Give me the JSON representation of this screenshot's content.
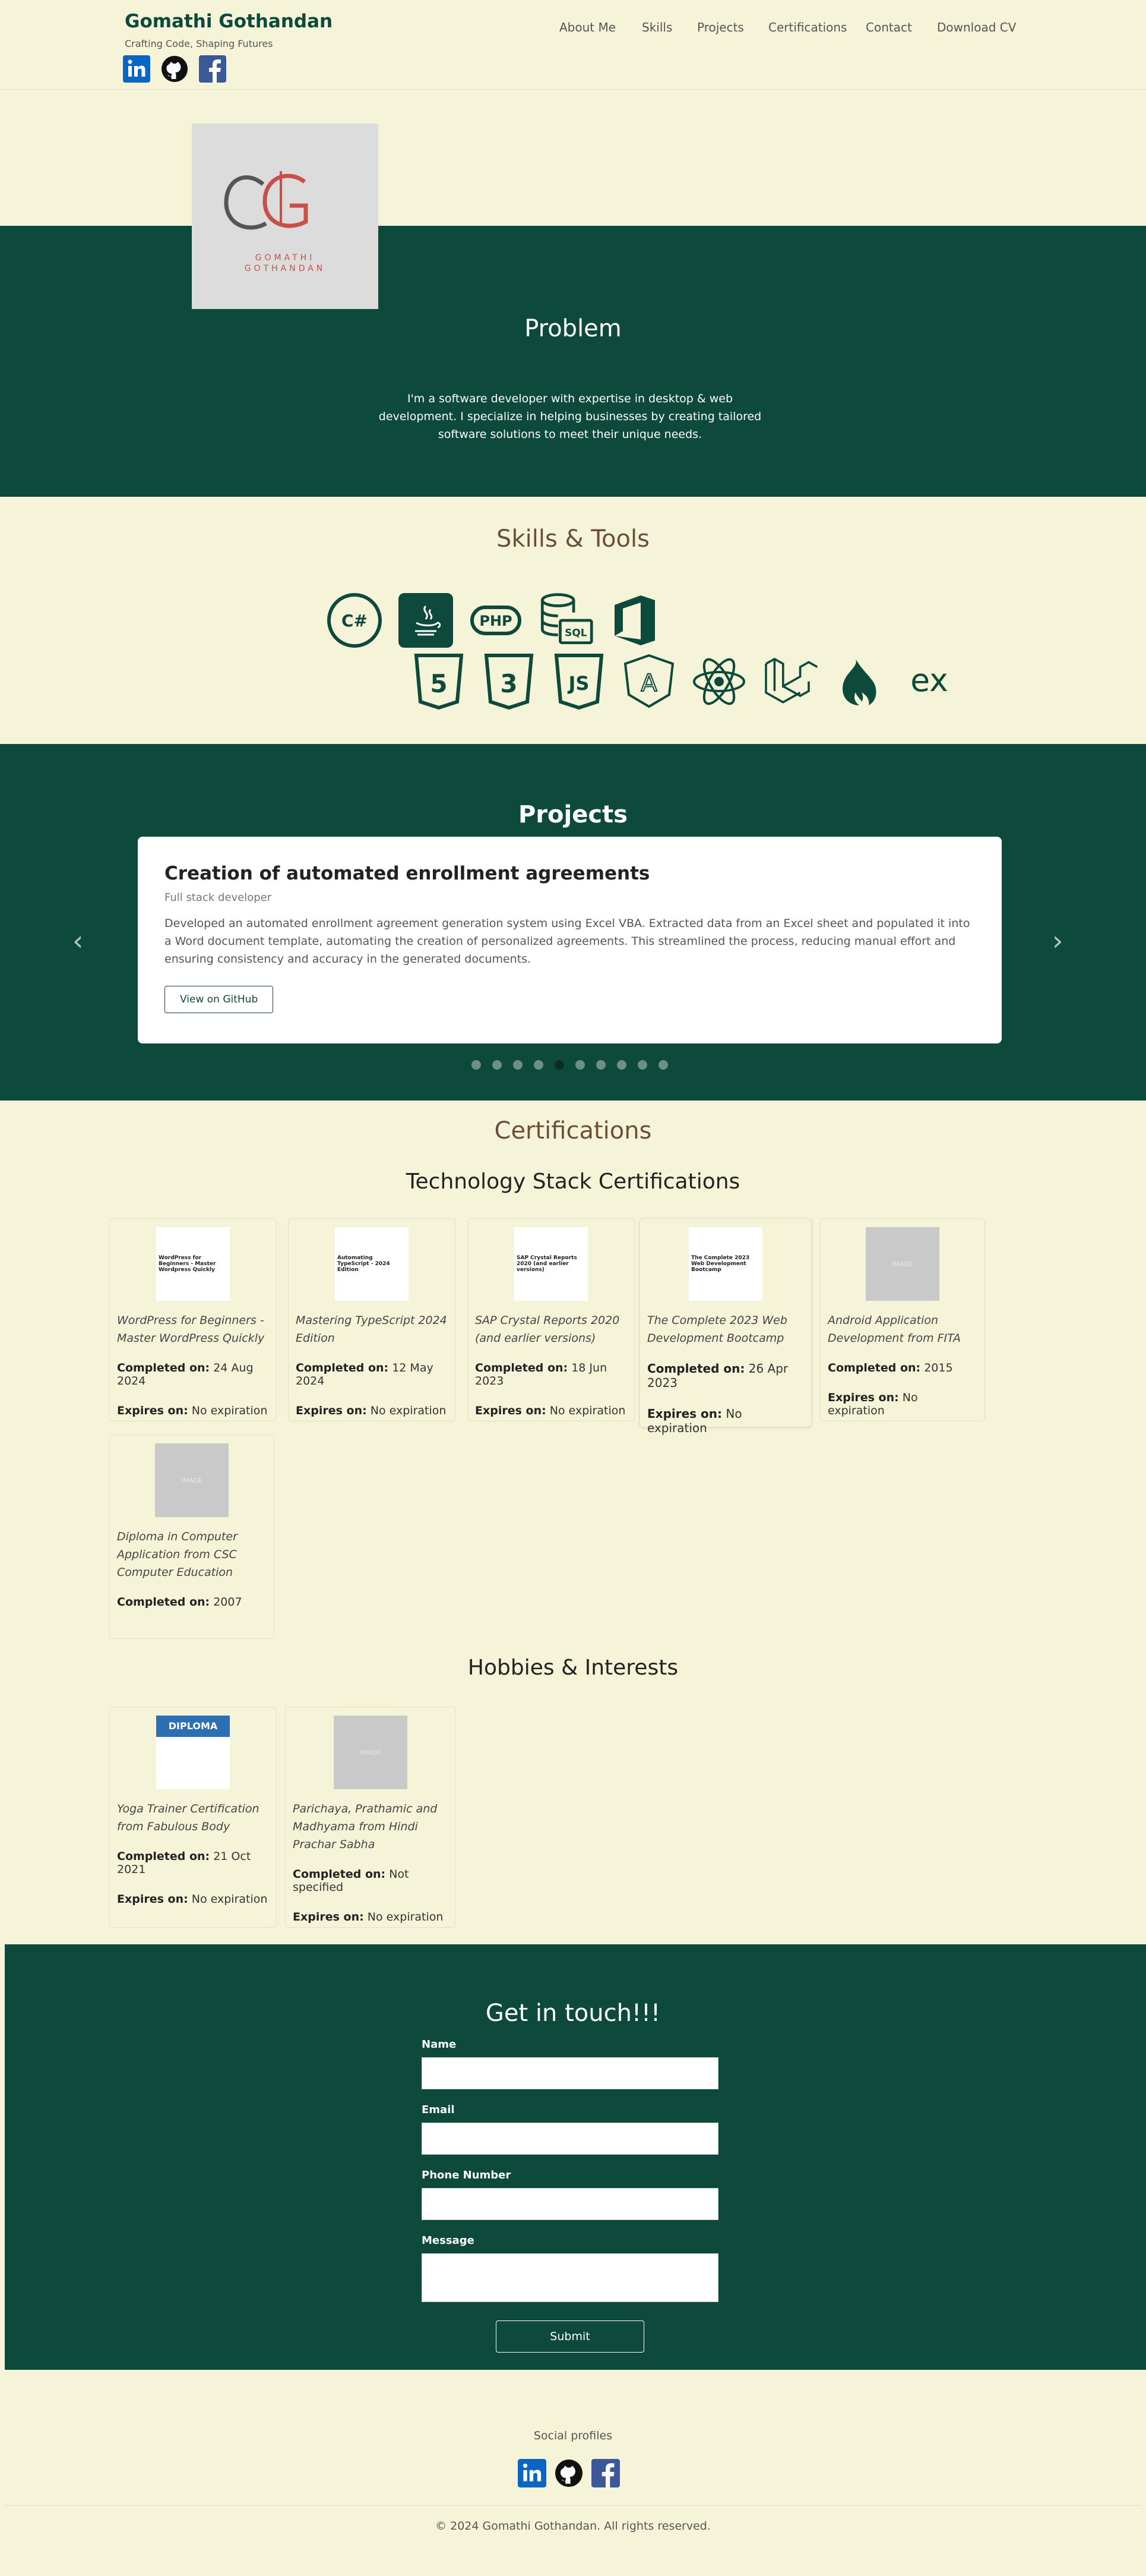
{
  "header": {
    "brand": "Gomathi Gothandan",
    "tagline": "Crafting Code, Shaping Futures",
    "nav": [
      "About Me",
      "Skills",
      "Projects",
      "Certifications",
      "Contact",
      "Download CV"
    ],
    "social_icons": [
      "linkedin-icon",
      "github-icon",
      "facebook-icon"
    ]
  },
  "hero": {
    "logo_initials": "GG",
    "logo_text_line1": "GOMATHI",
    "logo_text_line2": "GOTHANDAN",
    "title": "Problem",
    "intro": "I'm a software developer with expertise in desktop & web development. I specialize in helping businesses by creating tailored software solutions to meet their unique needs."
  },
  "skills": {
    "title": "Skills & Tools",
    "row1": [
      {
        "icon": "csharp-icon",
        "label": "C#"
      },
      {
        "icon": "java-icon",
        "label": ""
      },
      {
        "icon": "php-icon",
        "label": "PHP"
      },
      {
        "icon": "sql-icon",
        "label": "SQL"
      },
      {
        "icon": "office-icon",
        "label": ""
      }
    ],
    "row2": [
      {
        "icon": "html5-icon",
        "label": "5"
      },
      {
        "icon": "css3-icon",
        "label": "3"
      },
      {
        "icon": "javascript-icon",
        "label": "JS"
      },
      {
        "icon": "angular-icon",
        "label": "A"
      },
      {
        "icon": "react-icon",
        "label": ""
      },
      {
        "icon": "laravel-icon",
        "label": ""
      },
      {
        "icon": "codeigniter-icon",
        "label": ""
      },
      {
        "icon": "express-icon",
        "label": "ex"
      }
    ]
  },
  "projects": {
    "title": "Projects",
    "card": {
      "title": "Creation of automated enrollment agreements",
      "role": "Full stack developer",
      "description": "Developed an automated enrollment agreement generation system using Excel VBA. Extracted data from an Excel sheet and populated it into a Word document template, automating the creation of personalized agreements. This streamlined the process, reducing manual effort and ensuring consistency and accuracy in the generated documents.",
      "button": "View on GitHub"
    },
    "prev": "‹",
    "next": "›",
    "dot_count": 10,
    "active_dot": 4
  },
  "certifications": {
    "title": "Certifications",
    "tech_title": "Technology Stack Certifications",
    "completed_label": "Completed on:",
    "expires_label": "Expires on:",
    "tech": [
      {
        "name": "WordPress for Beginners - Master WordPress Quickly",
        "completed": "24 Aug 2024",
        "expires": "No expiration",
        "thumb_text": "WordPress for Beginners - Master Wordpress Quickly",
        "placeholder": false
      },
      {
        "name": "Mastering TypeScript 2024 Edition",
        "completed": "12 May 2024",
        "expires": "No expiration",
        "thumb_text": "Automating TypeScript - 2024 Edition",
        "placeholder": false
      },
      {
        "name": "SAP Crystal Reports 2020 (and earlier versions)",
        "completed": "18 Jun 2023",
        "expires": "No expiration",
        "thumb_text": "SAP Crystal Reports 2020 (and earlier versions)",
        "placeholder": false
      },
      {
        "name": "The Complete 2023 Web Development Bootcamp",
        "completed": "26 Apr 2023",
        "expires": "No expiration",
        "thumb_text": "The Complete 2023 Web Development Bootcamp",
        "placeholder": false
      },
      {
        "name": "Android Application Development from FITA",
        "completed": "2015",
        "expires": "No expiration",
        "thumb_text": "IMAGE",
        "placeholder": true
      },
      {
        "name": "Diploma in Computer Application from CSC Computer Education",
        "completed": "2007",
        "expires": "",
        "thumb_text": "IMAGE",
        "placeholder": true
      }
    ],
    "hobbies_title": "Hobbies & Interests",
    "hobbies": [
      {
        "name": "Yoga Trainer Certification from Fabulous Body",
        "completed": "21 Oct 2021",
        "expires": "No expiration",
        "thumb_text": "DIPLOMA",
        "placeholder": false
      },
      {
        "name": "Parichaya, Prathamic and Madhyama from Hindi Prachar Sabha",
        "completed": "Not specified",
        "expires": "No expiration",
        "thumb_text": "IMAGE",
        "placeholder": true
      }
    ]
  },
  "contact": {
    "title": "Get in touch!!!",
    "fields": [
      {
        "label": "Name",
        "value": ""
      },
      {
        "label": "Email",
        "value": ""
      },
      {
        "label": "Phone Number",
        "value": ""
      },
      {
        "label": "Message",
        "value": ""
      }
    ],
    "submit": "Submit"
  },
  "footer": {
    "social_label": "Social profiles",
    "copyright": "© 2024 Gomathi Gothandan. All rights reserved."
  },
  "colors": {
    "primary": "#0e4a3b",
    "background": "#f5f4d9",
    "heading_brown": "#6b4f3a",
    "linkedin": "#0a66c2",
    "facebook": "#3b5998"
  }
}
